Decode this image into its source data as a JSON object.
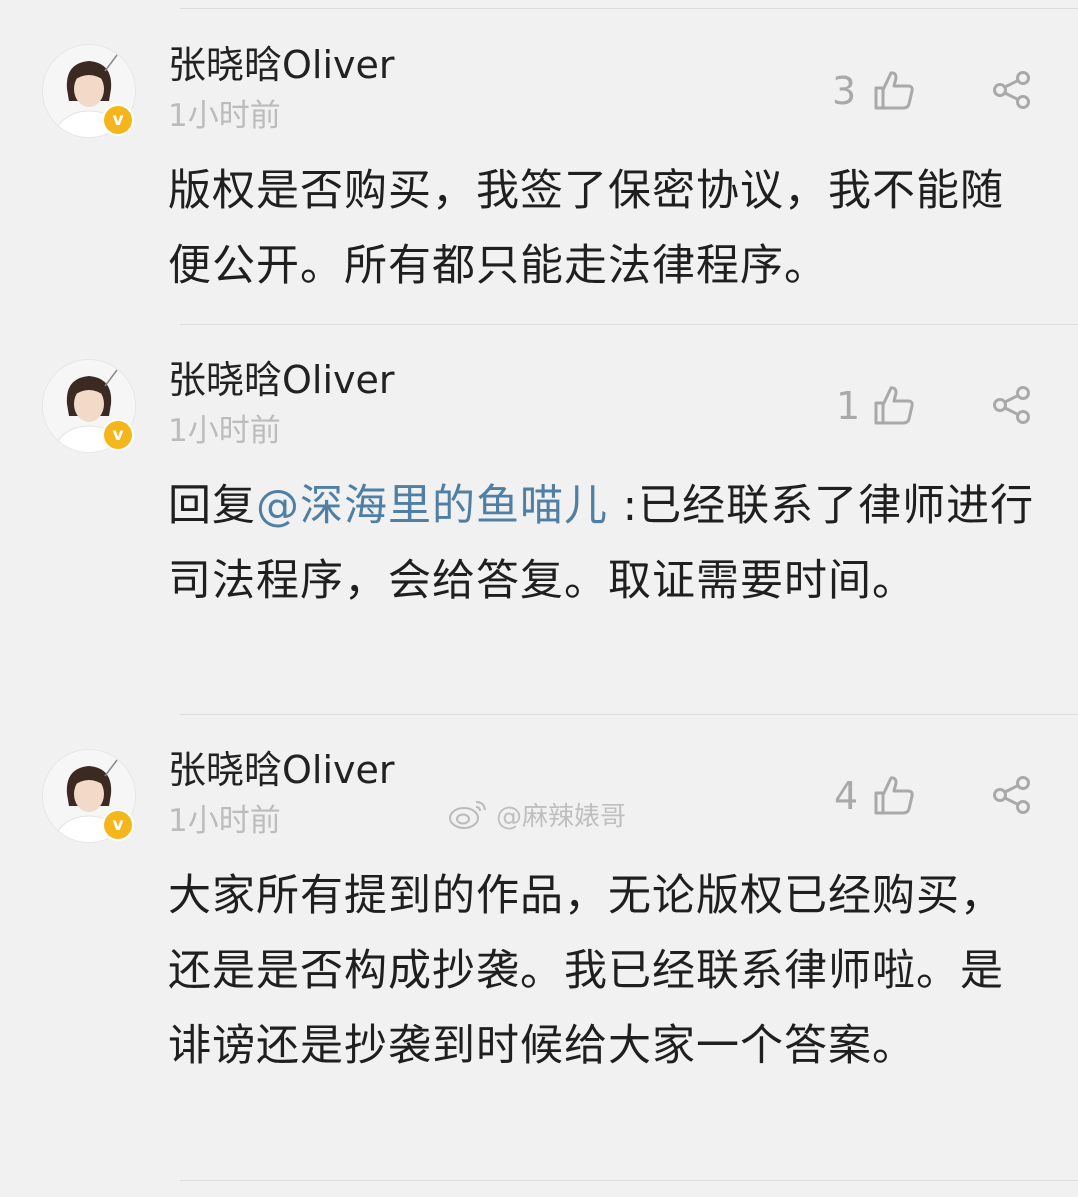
{
  "comments": [
    {
      "username": "张晓晗Oliver",
      "time": "1小时前",
      "likes": "3",
      "body": "版权是否购买，我签了保密协议，我不能随便公开。所有都只能走法律程序。"
    },
    {
      "username": "张晓晗Oliver",
      "time": "1小时前",
      "likes": "1",
      "reply_prefix": "回复",
      "mention": "@深海里的鱼喵儿",
      "body": " :已经联系了律师进行司法程序，会给答复。取证需要时间。"
    },
    {
      "username": "张晓晗Oliver",
      "time": "1小时前",
      "likes": "4",
      "body": "大家所有提到的作品，无论版权已经购买，还是是否构成抄袭。我已经联系律师啦。是诽谤还是抄袭到时候给大家一个答案。"
    }
  ],
  "verified_badge": "v",
  "watermark": "@麻辣婊哥",
  "colors": {
    "background": "#f1f1f1",
    "mention": "#4f7fa4",
    "verified": "#f5b51d",
    "muted": "#bcbcbc"
  }
}
